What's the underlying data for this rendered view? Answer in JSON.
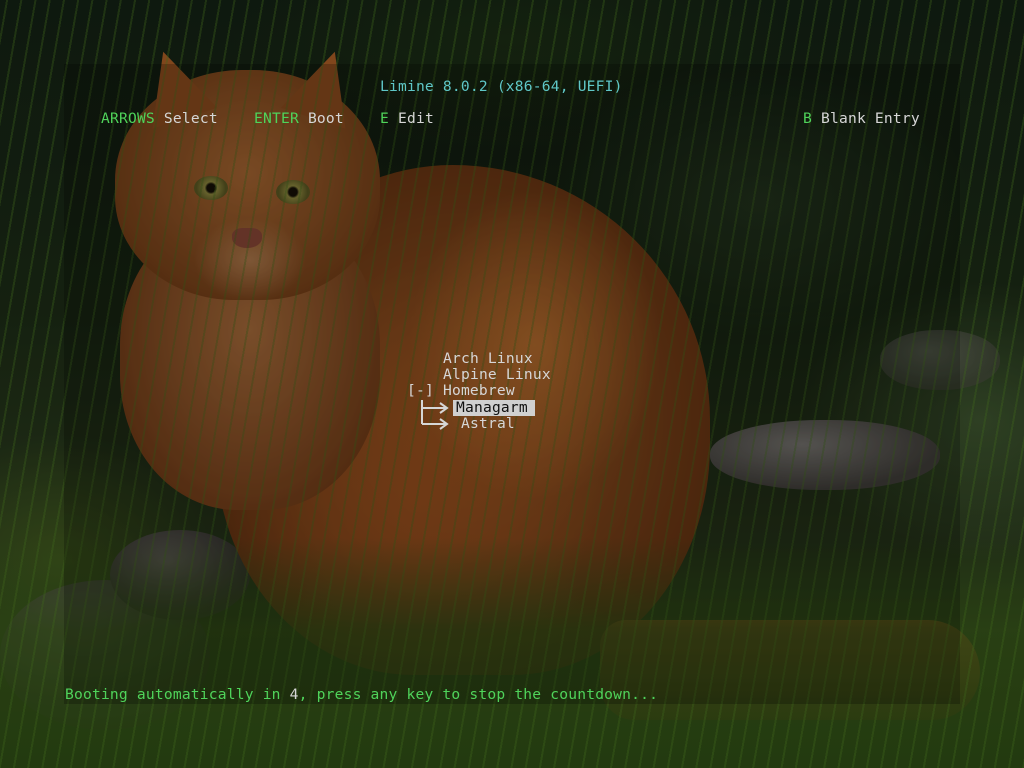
{
  "header": {
    "title": "Limine 8.0.2 (x86-64, UEFI)"
  },
  "hints": [
    {
      "key": "ARROWS",
      "action": "Select"
    },
    {
      "key": "ENTER",
      "action": "Boot"
    },
    {
      "key": "E",
      "action": "Edit"
    },
    {
      "key": "B",
      "action": "Blank Entry"
    }
  ],
  "menu": {
    "entries": [
      {
        "label": "Arch Linux"
      },
      {
        "label": "Alpine Linux"
      },
      {
        "label": "Homebrew",
        "expand_marker": "[-]"
      },
      {
        "label": "Managarm",
        "selected": true
      },
      {
        "label": "Astral"
      }
    ]
  },
  "footer": {
    "text_before": "Booting automatically in ",
    "countdown": "4",
    "text_after": ", press any key to stop the countdown..."
  },
  "colors": {
    "title": "#5fc7c7",
    "key": "#4fd35a",
    "text": "#d6d6d6",
    "selection_bg": "#d0d0d0"
  }
}
